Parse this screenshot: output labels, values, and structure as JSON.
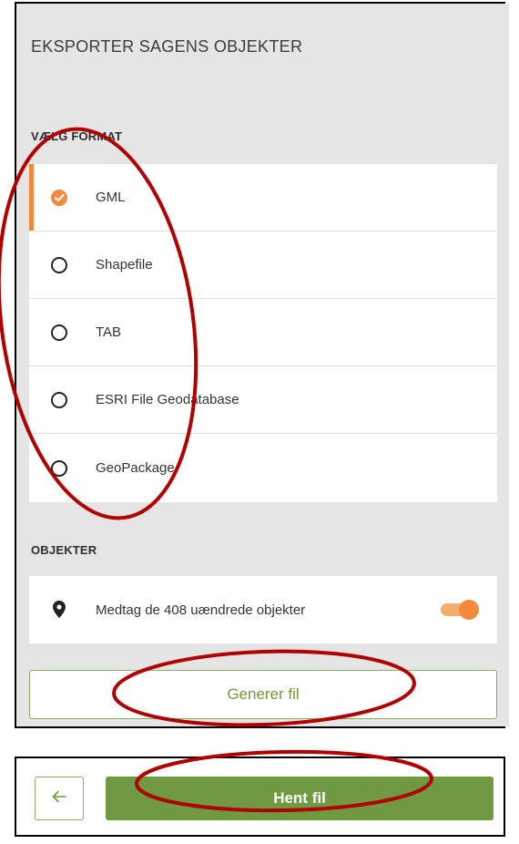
{
  "export_panel": {
    "title": "EKSPORTER SAGENS OBJEKTER",
    "format_section_label": "VÆLG FORMAT",
    "formats": [
      {
        "label": "GML",
        "selected": true
      },
      {
        "label": "Shapefile",
        "selected": false
      },
      {
        "label": "TAB",
        "selected": false
      },
      {
        "label": "ESRI File Geodatabase",
        "selected": false
      },
      {
        "label": "GeoPackage",
        "selected": false
      }
    ],
    "objects_section_label": "OBJEKTER",
    "include_unchanged_label": "Medtag de 408 uændrede objekter",
    "include_unchanged_enabled": true,
    "generate_button_label": "Generer fil"
  },
  "download_panel": {
    "back_icon": "arrow-left-icon",
    "download_button_label": "Hent fil"
  },
  "colors": {
    "accent": "#f5893b",
    "green": "#6f9a43",
    "green_outline": "#8cae62",
    "panel_bg": "#e5e5e5",
    "annotation": "#b00000"
  }
}
